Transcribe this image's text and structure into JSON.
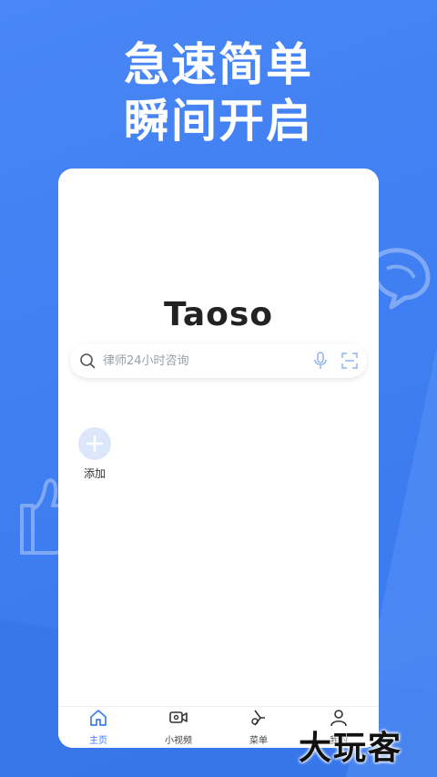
{
  "promo": {
    "headline_line1": "急速简单",
    "headline_line2": "瞬间开启"
  },
  "app": {
    "logo_text": "Taoso"
  },
  "search": {
    "placeholder": "律师24小时咨询"
  },
  "shortcuts": [
    {
      "label": "添加"
    }
  ],
  "tabbar": {
    "items": [
      {
        "label": "主页",
        "icon": "home-icon",
        "active": true
      },
      {
        "label": "小视频",
        "icon": "video-icon",
        "active": false
      },
      {
        "label": "菜单",
        "icon": "menu-icon",
        "active": false
      },
      {
        "label": "我的",
        "icon": "user-icon",
        "active": false
      }
    ]
  },
  "watermark": {
    "text": "大玩客"
  },
  "colors": {
    "background": "#4080f2",
    "accent": "#3b7cf0",
    "add_circle": "#dde7fb"
  }
}
